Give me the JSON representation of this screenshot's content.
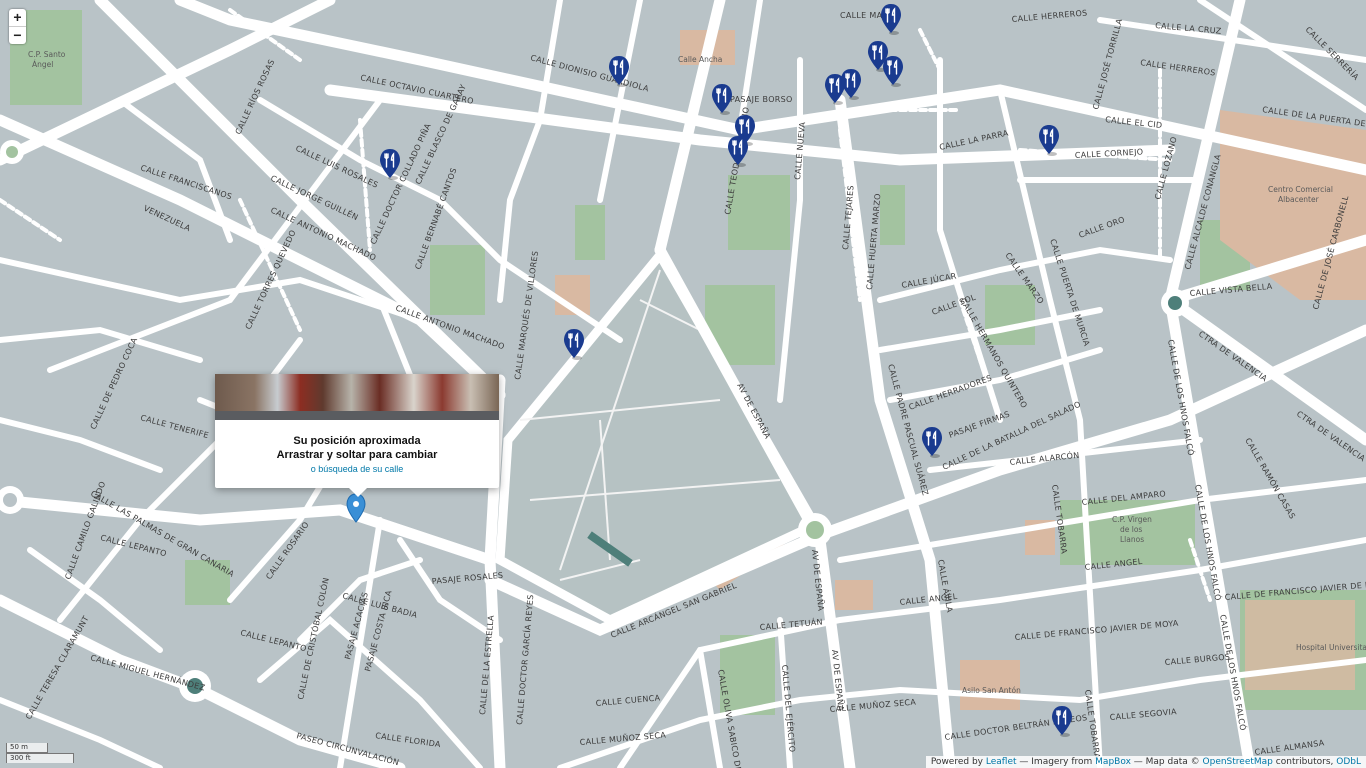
{
  "zoom": {
    "in_label": "+",
    "out_label": "−"
  },
  "popup": {
    "line1": "Su posición aproximada",
    "line2": "Arrastrar y soltar para cambiar",
    "link": "o búsqueda de su calle"
  },
  "scale": {
    "metric": "50 m",
    "imperial": "300 ft"
  },
  "attribution": {
    "prefix": "Powered by",
    "leaflet": "Leaflet",
    "imagery": "— Imagery from",
    "mapbox": "MapBox",
    "mapdata": "— Map data ©",
    "osm": "OpenStreetMap",
    "contributors": "contributors,",
    "odbl": "ODbL"
  },
  "streets": {
    "octavio": "CALLE OCTAVIO CUARTERO",
    "dionisio": "CALLE DIONISIO GUARDIOLA",
    "parra": "CALLE LA PARRA",
    "cid": "CALLE EL CID",
    "conangla": "CALLE ALCALDE CONANGLA",
    "carbonell": "CALLE DE JOSÉ CARBONELL",
    "ctra_valencia": "CTRA DE VALENCIA",
    "ctra_valencia2": "CTRA DE VALENCIA",
    "av_espana": "AV DE ESPAÑA",
    "av_espana2": "AV DE ESPAÑA",
    "av_espana3": "AV DE ESPAÑA",
    "batalla": "CALLE DE LA BATALLA DEL SALADO",
    "arcangel": "CALLE ARCÁNGEL SAN GABRIEL",
    "hnos_falco": "CALLE DE LOS HNOS FALCÓ",
    "hnos_falco2": "CALLE DE LOS HNOS FALCÓ",
    "hnos_falco3": "CALLE DE LOS HNOS FALCÓ",
    "circunvalacion": "PASEO CIRCUNVALACIÓN",
    "lepanto": "CALLE LEPANTO",
    "lepanto2": "CALLE LEPANTO",
    "rosario": "CALLE ROSARIO",
    "angel": "CALLE ANGEL",
    "angel2": "CALLE ANGEL",
    "moya": "CALLE DE FRANCISCO JAVIER DE MOYA",
    "moya2": "CALLE DE FRANCISCO JAVIER DE MOYA",
    "tetuan": "CALLE TETUÁN",
    "munoz_seca": "CALLE MUÑOZ SECA",
    "munoz_seca2": "CALLE MUÑOZ SECA",
    "beltran": "CALLE DOCTOR BELTRÁN MATEOS",
    "segovia": "CALLE SEGOVIA",
    "almansa": "CALLE ALMANSA",
    "alarcon": "CALLE ALARCÓN",
    "amparo": "CALLE DEL AMPARO",
    "tobarra": "CALLE TOBARRA",
    "tobarra2": "CALLE TOBARRA",
    "florida": "CALLE FLORIDA",
    "cuenca": "CALLE CUENCA",
    "burgos": "CALLE BURGOS",
    "herreros": "CALLE HERREROS",
    "herreros2": "CALLE HERREROS",
    "cornejo": "CALLE CORNEJO",
    "mayor": "CALLE MAYOR",
    "nueva": "CALLE NUEVA",
    "tejares": "CALLE TEJARES",
    "jucar": "CALLE JÚCAR",
    "sol": "CALLE SOL",
    "marzo": "CALLE MARZO",
    "oro": "CALLE ORO",
    "franciscanos": "CALLE FRANCISCANOS",
    "rios_rosas": "CALLE RÍOS ROSAS",
    "luis_rosales": "CALLE LUIS ROSALES",
    "garay": "CALLE BLASCO DE GARAY",
    "teodoro": "CALLE TEODORO CAMINO",
    "ancha": "Calle Ancha",
    "borso": "PASAJE BORSO",
    "rosales": "PASAJE ROSALES",
    "luis_badia": "CALLE LUIS BADIA",
    "cristobal": "CALLE DE CRISTÓBAL COLÓN",
    "estrella": "CALLE DE LA ESTRELLA",
    "garcia_reyes": "CALLE DOCTOR GARCÍA REYES",
    "herradores": "CALLE HERRADORES",
    "firmas": "PASAJE FIRMAS",
    "pascual": "CALLE PADRE PASCUAL SUÁREZ",
    "quintero": "CALLE HERMANOS QUINTERO",
    "murcia": "CALLE PUERTA DE MURCIA",
    "vista_bella": "CALLE VISTA BELLA",
    "lozano": "CALLE LOZANO",
    "ramon_casas": "CALLE RAMÓN CASAS",
    "avila": "CALLE ÁVILA",
    "camilo": "CALLE CAMILO GALINDO",
    "palmas": "CALLE LAS PALMAS DE GRAN CANARIA",
    "miguel": "CALLE MIGUEL HERNÁNDEZ",
    "teresa": "CALLE TERESA CLARAMUNT",
    "tenerife": "CALLE TENERIFE",
    "cuba": "CALLE DE PEDRO COCA",
    "acacias": "PASAJE ACACIAS",
    "costa_rica": "PASAJE COSTA RICA",
    "machado": "CALLE ANTONIO MACHADO",
    "machado2": "CALLE ANTONIO MACHADO",
    "torres": "CALLE TORRES QUEVEDO",
    "colegio": "CALLE DOCTOR COLLADO PIÑA",
    "marques": "CALLE MARQUÉS DE VILLORES",
    "huerta": "CALLE HUERTA MARZO",
    "puerta_chinchilla": "CALLE DE LA PUERTA DE CHINCHILLA",
    "la_cruz": "CALLE LA CRUZ",
    "torrilla": "CALLE JOSÉ TORRILLA",
    "serreria": "CALLE SERRERÍA",
    "jorge_guillen": "CALLE JORGE GUILLÉN",
    "bernabe": "CALLE BERNABÉ CANTOS",
    "venezuela": "VENEZUELA",
    "oliva": "CALLE OLIVA SABICO DE NAVA",
    "ejercito": "CALLE DEL EJÉRCITO"
  },
  "pois": {
    "santo_angel1": "C.P. Santo",
    "santo_angel2": "Ángel",
    "centro1": "Centro Comercial",
    "centro2": "Albacenter",
    "virgen1": "C.P. Virgen",
    "virgen2": "de los",
    "virgen3": "Llanos",
    "hospital": "Hospital Universitari",
    "asilo": "Asilo San Antón"
  },
  "marker_icon": "restaurant-icon",
  "location_icon": "location-pin-icon",
  "restaurant_markers": [
    {
      "name": "restaurant-1"
    },
    {
      "name": "restaurant-2"
    },
    {
      "name": "restaurant-3"
    },
    {
      "name": "restaurant-4"
    },
    {
      "name": "restaurant-5"
    },
    {
      "name": "restaurant-6"
    },
    {
      "name": "restaurant-7"
    },
    {
      "name": "restaurant-8"
    },
    {
      "name": "restaurant-9"
    },
    {
      "name": "restaurant-10"
    },
    {
      "name": "restaurant-11"
    },
    {
      "name": "restaurant-12"
    },
    {
      "name": "restaurant-13"
    },
    {
      "name": "restaurant-14"
    }
  ],
  "colors": {
    "land": "#b9c3c7",
    "road": "#ffffff",
    "park": "#a3c3a0",
    "building": "#d9b9a2",
    "marker": "#1a3b8f",
    "location_pin": "#3a8fd6",
    "link": "#0078a8"
  }
}
